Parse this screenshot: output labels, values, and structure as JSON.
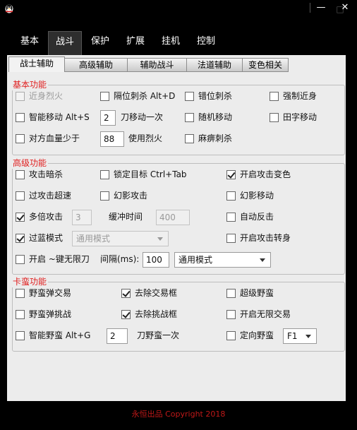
{
  "window": {
    "app_icon": "penguin-icon",
    "buttons": [
      "minimize",
      "maximize",
      "close"
    ],
    "glyphs": {
      "minimize": "—",
      "maximize": "□",
      "close": "✕"
    }
  },
  "nav": {
    "tabs": [
      "基本",
      "战斗",
      "保护",
      "扩展",
      "挂机",
      "控制"
    ],
    "active": "战斗"
  },
  "subtabs": {
    "items": [
      "战士辅助",
      "高级辅助",
      "辅助战斗",
      "法道辅助",
      "变色相关"
    ],
    "active": "战士辅助"
  },
  "basic": {
    "title": "基本功能",
    "items": {
      "jinshen_liehuo": {
        "label": "近身烈火",
        "checked": false,
        "disabled": true
      },
      "gewei_cisha": {
        "label": "隔位刺杀 Alt+D",
        "checked": false
      },
      "cuowei_cisha": {
        "label": "错位刺杀",
        "checked": false
      },
      "qiangzhi_jinshen": {
        "label": "强制近身",
        "checked": false
      },
      "zhineng_yidong": {
        "label": "智能移动 Alt+S",
        "checked": false
      },
      "dao_yidong_value": "2",
      "dao_yidong_suffix": "刀移动一次",
      "suiji_yidong": {
        "label": "随机移动",
        "checked": false
      },
      "tianzi_yidong": {
        "label": "田字移动",
        "checked": false
      },
      "hp_less": {
        "label": "对方血量少于",
        "checked": false
      },
      "hp_value": "88",
      "hp_suffix": "使用烈火",
      "mabi_cisha": {
        "label": "麻痹刺杀",
        "checked": false
      }
    }
  },
  "advanced": {
    "title": "高级功能",
    "items": {
      "gongji_ansha": {
        "label": "攻击暗杀",
        "checked": false
      },
      "suoding_mubiao": {
        "label": "锁定目标 Ctrl+Tab",
        "checked": false
      },
      "kaiqi_gongji_bianse": {
        "label": "开启攻击变色",
        "checked": true
      },
      "guo_gongji_chaosu": {
        "label": "过攻击超速",
        "checked": false
      },
      "huanying_gongji": {
        "label": "幻影攻击",
        "checked": false
      },
      "huanying_yidong": {
        "label": "幻影移动",
        "checked": false
      },
      "duobei_gongji": {
        "label": "多倍攻击",
        "checked": true
      },
      "duobei_value": "3",
      "huanchong_label": "缓冲时间",
      "huanchong_value": "400",
      "zidong_fanji": {
        "label": "自动反击",
        "checked": false
      },
      "guolan_moshi": {
        "label": "过蓝模式",
        "checked": true
      },
      "guolan_select": "通用模式",
      "kaiqi_gongji_zhuanshen": {
        "label": "开启攻击转身",
        "checked": false
      },
      "wuxiandao": {
        "label": "开启 ~键无限刀",
        "checked": false
      },
      "interval_label": "间隔(ms):",
      "interval_value": "100",
      "interval_mode": "通用模式"
    }
  },
  "kaman": {
    "title": "卡蛮功能",
    "items": {
      "yeman_dan_jiaoyi": {
        "label": "野蛮弹交易",
        "checked": false
      },
      "quchu_jiaoyikuang": {
        "label": "去除交易框",
        "checked": true
      },
      "chaoji_yeman": {
        "label": "超级野蛮",
        "checked": false
      },
      "yeman_dan_tiaozhan": {
        "label": "野蛮弹挑战",
        "checked": false
      },
      "quchu_tiaozhankuang": {
        "label": "去除挑战框",
        "checked": true
      },
      "kaiqi_wuxian_jiaoyi": {
        "label": "开启无限交易",
        "checked": false
      },
      "zhineng_yeman": {
        "label": "智能野蛮 Alt+G",
        "checked": false
      },
      "yeman_value": "2",
      "yeman_suffix": "刀野蛮一次",
      "dingxiang_yeman": {
        "label": "定向野蛮",
        "checked": false
      },
      "dingxiang_key": "F1"
    }
  },
  "footer": {
    "text": "永恒出品  Copyright 2018"
  }
}
